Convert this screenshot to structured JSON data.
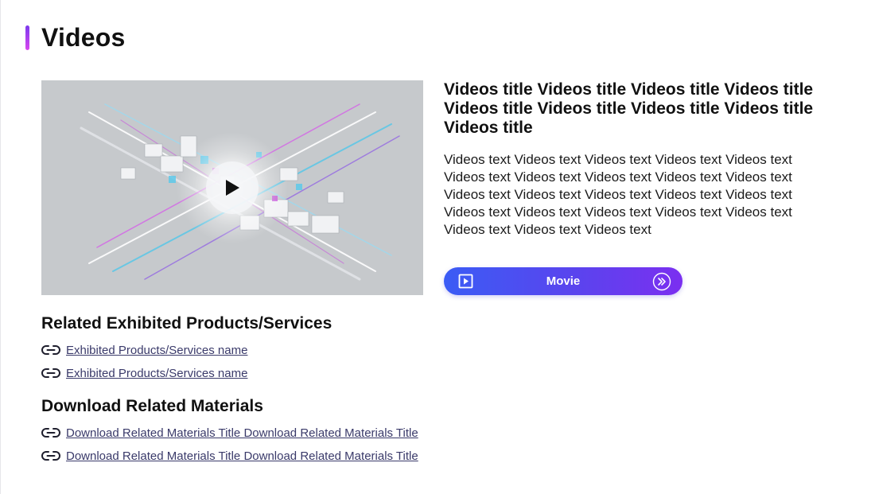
{
  "section": {
    "title": "Videos"
  },
  "video": {
    "title": "Videos title Videos title Videos title Videos title Videos title Videos title Videos title Videos title Videos title",
    "text": "Videos text Videos text Videos text Videos text Videos text Videos text Videos text Videos text Videos text Videos text Videos text Videos text Videos text Videos text Videos text Videos text Videos text Videos text Videos text Videos text Videos text Videos text Videos text",
    "button_label": "Movie"
  },
  "related_products": {
    "heading": "Related Exhibited Products/Services",
    "items": [
      {
        "label": "Exhibited Products/Services name"
      },
      {
        "label": "Exhibited Products/Services name"
      }
    ]
  },
  "downloads": {
    "heading": "Download Related Materials",
    "items": [
      {
        "label": "Download Related Materials Title Download Related Materials Title"
      },
      {
        "label": "Download Related Materials Title Download Related Materials Title"
      }
    ]
  },
  "colors": {
    "accent_start": "#7c3aed",
    "accent_end": "#d946ef",
    "button_start": "#3b5cf5",
    "button_end": "#7b2ff0",
    "link": "#3a3a6a"
  },
  "icons": {
    "play": "play-icon",
    "link": "link-icon",
    "movie_left": "play-square-icon",
    "movie_right": "double-chevron-right-icon"
  }
}
